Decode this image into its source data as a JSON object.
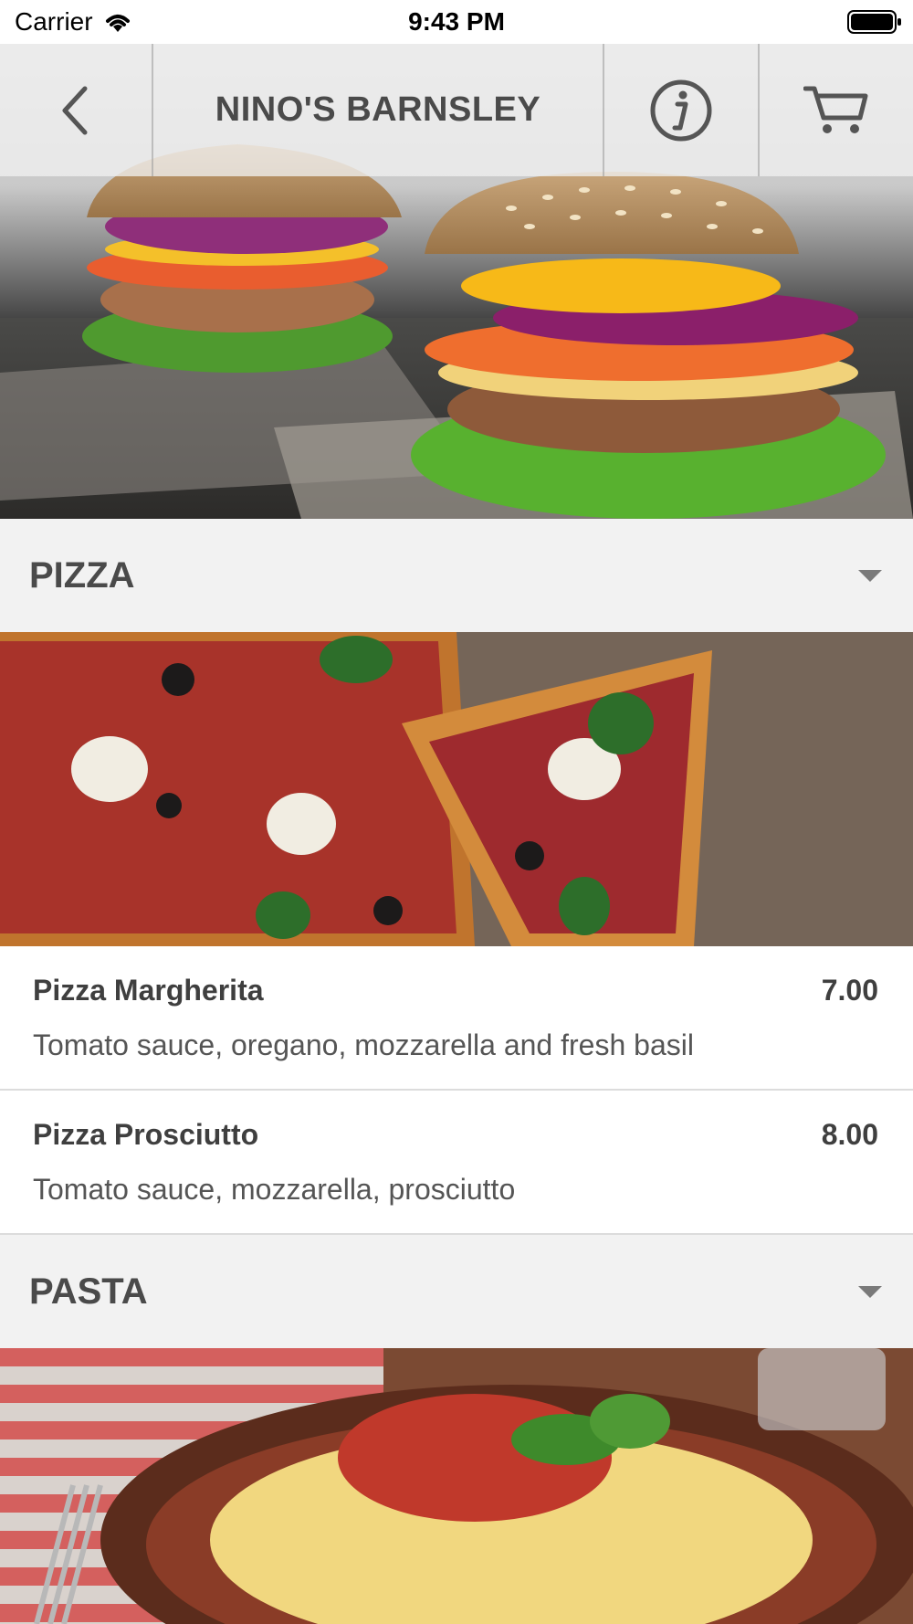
{
  "status_bar": {
    "carrier": "Carrier",
    "time": "9:43 PM"
  },
  "header": {
    "title": "NINO'S BARNSLEY",
    "back_icon": "chevron-left-icon",
    "info_icon": "info-icon",
    "cart_icon": "cart-icon"
  },
  "sections": [
    {
      "label": "PIZZA",
      "items": [
        {
          "name": "Pizza Margherita",
          "price": "7.00",
          "description": "Tomato sauce, oregano, mozzarella and fresh basil"
        },
        {
          "name": "Pizza Prosciutto",
          "price": "8.00",
          "description": "Tomato sauce, mozzarella, prosciutto"
        }
      ]
    },
    {
      "label": "PASTA",
      "items": []
    }
  ],
  "colors": {
    "header_text": "#4a4a4a",
    "section_bg": "#f2f2f2",
    "divider": "#dcdcdc"
  }
}
